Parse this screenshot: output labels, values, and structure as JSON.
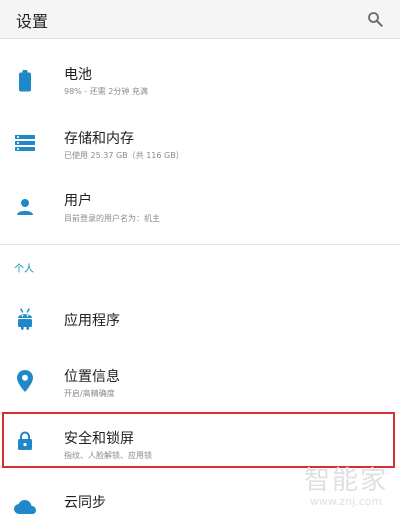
{
  "header": {
    "title": "设置",
    "search_icon": "search-icon"
  },
  "accent_color": "#1e88c8",
  "items": [
    {
      "title": "电池",
      "subtitle": "98% - 还需 2分钟 充满",
      "icon": "battery-icon"
    },
    {
      "title": "存储和内存",
      "subtitle": "已使用 25.37 GB（共 116 GB）",
      "icon": "storage-icon"
    },
    {
      "title": "用户",
      "subtitle": "目前登录的用户名为：机主",
      "icon": "user-icon"
    }
  ],
  "section": {
    "label": "个人"
  },
  "personal_items": [
    {
      "title": "应用程序",
      "subtitle": "",
      "icon": "android-icon"
    },
    {
      "title": "位置信息",
      "subtitle": "开启/高精确度",
      "icon": "location-icon"
    },
    {
      "title": "安全和锁屏",
      "subtitle": "指纹、人脸解锁、应用锁",
      "icon": "lock-icon",
      "highlighted": true
    },
    {
      "title": "云同步",
      "subtitle": "",
      "icon": "cloud-icon"
    }
  ],
  "watermark": {
    "text": "智能家",
    "url": "www.znj.com"
  }
}
